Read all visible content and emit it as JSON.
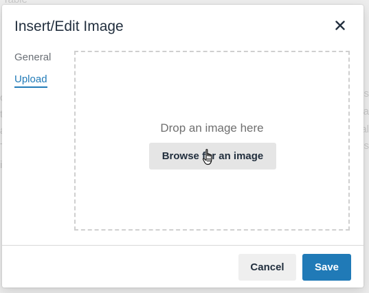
{
  "background": {
    "top_text": "Table",
    "right_fragments": [
      "us",
      "ta",
      "al",
      "s"
    ],
    "left_fragments": [
      "c",
      "t",
      "a",
      "T",
      "i"
    ]
  },
  "dialog": {
    "title": "Insert/Edit Image",
    "close_icon": "close-icon"
  },
  "tabs": [
    {
      "label": "General",
      "active": false
    },
    {
      "label": "Upload",
      "active": true
    }
  ],
  "dropzone": {
    "prompt": "Drop an image here",
    "browse_label": "Browse for an image"
  },
  "footer": {
    "cancel_label": "Cancel",
    "save_label": "Save"
  },
  "colors": {
    "accent": "#207ab7",
    "title_text": "#222f3e"
  }
}
